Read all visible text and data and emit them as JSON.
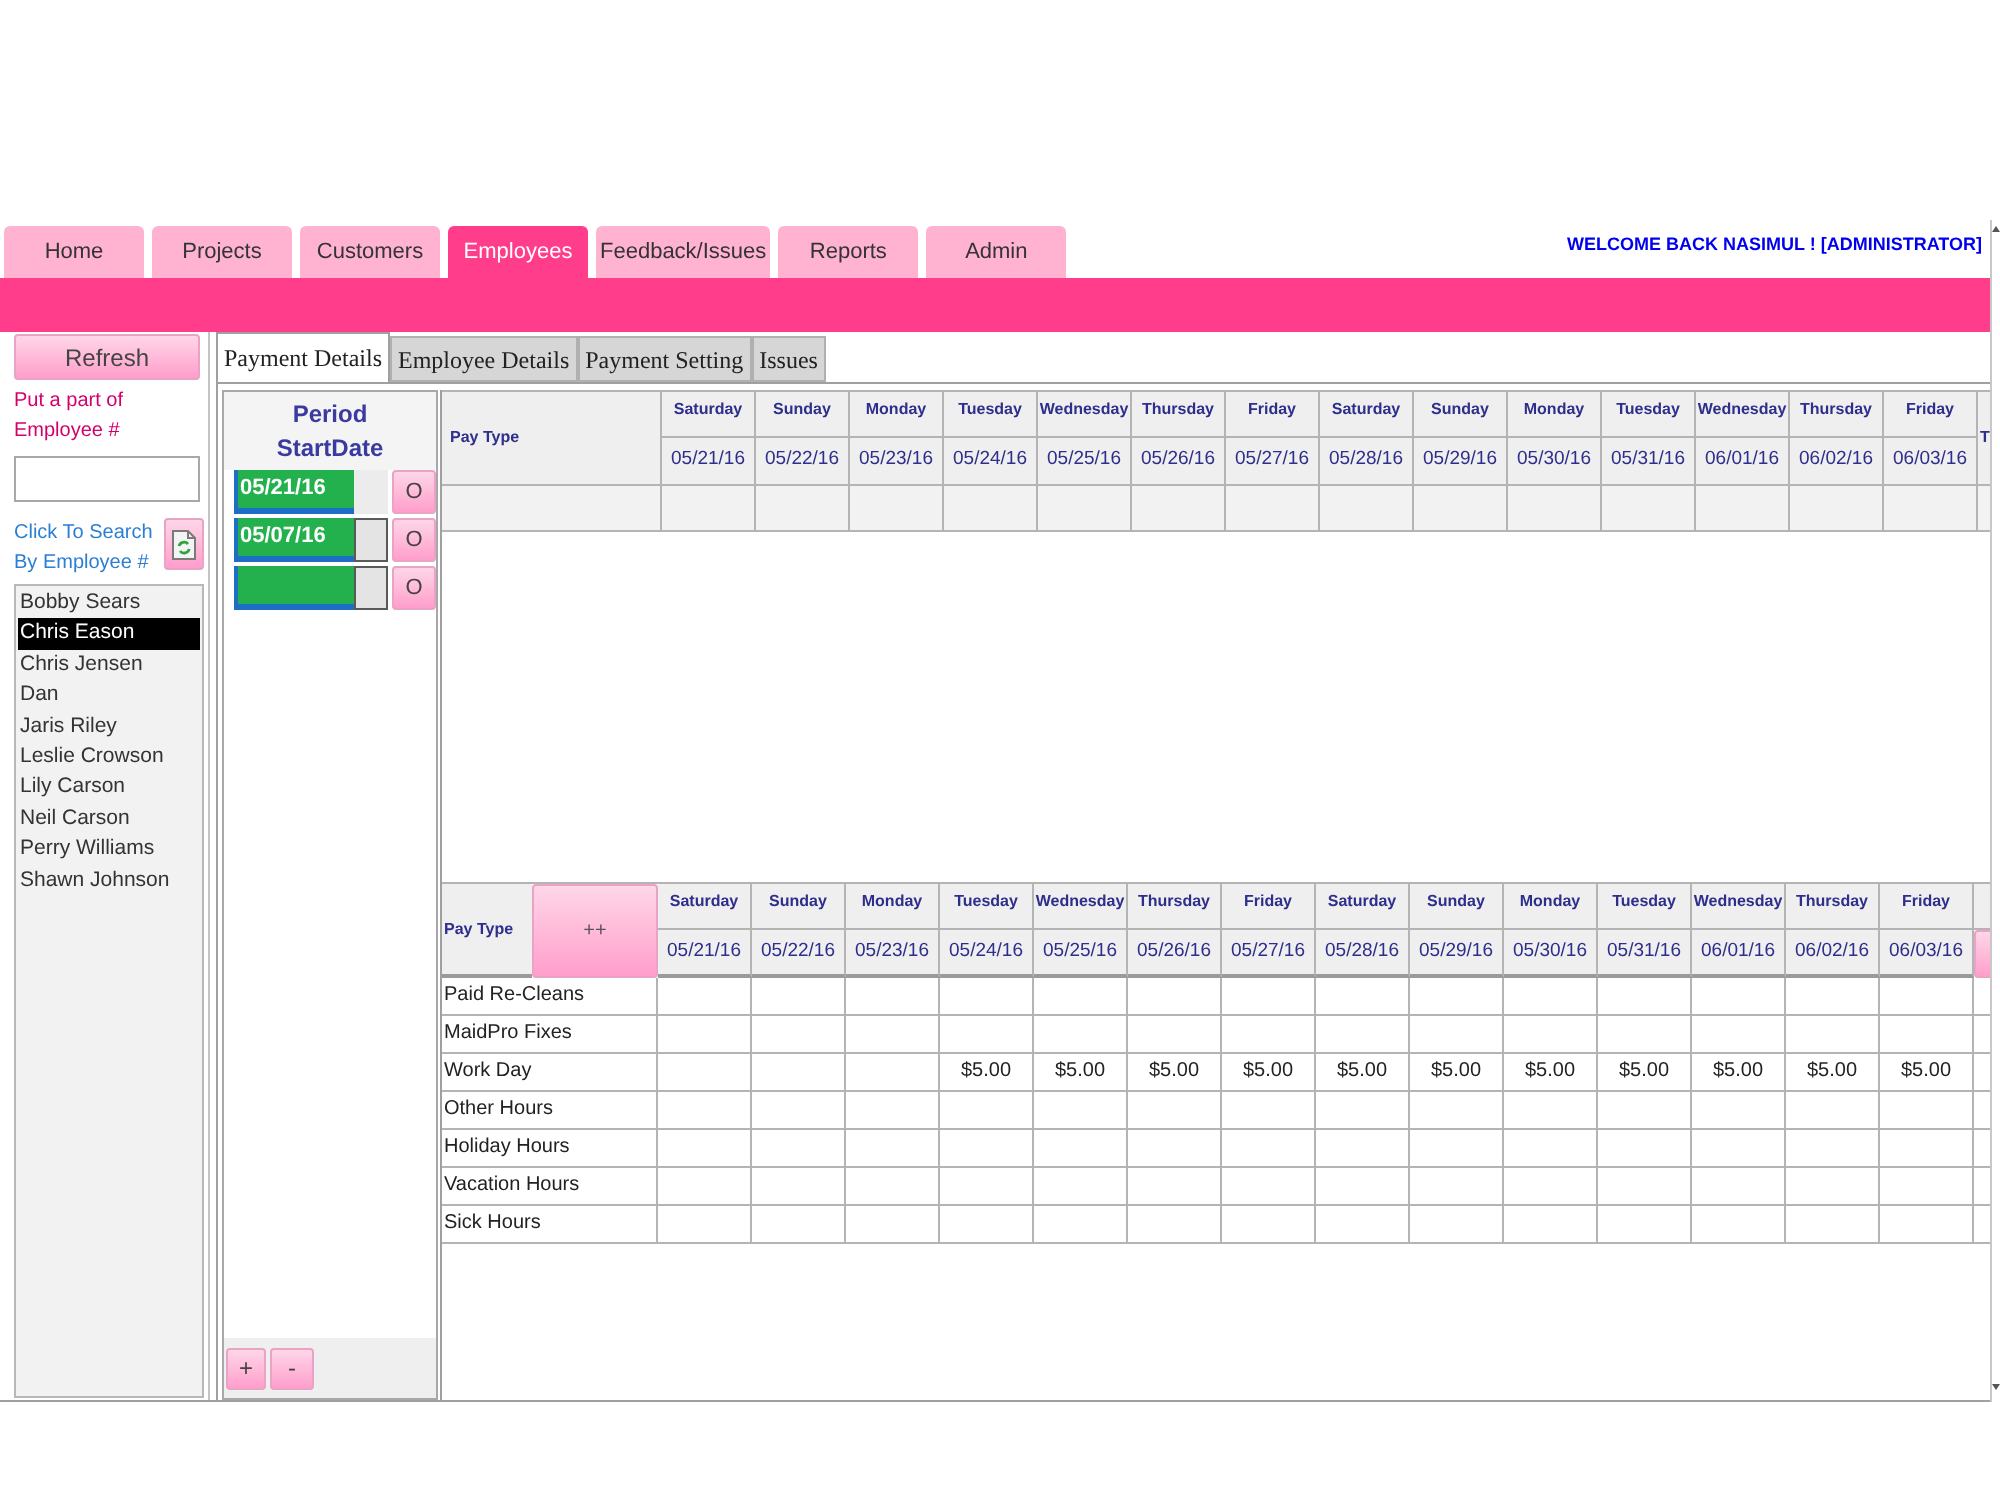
{
  "nav": {
    "tabs": [
      {
        "label": "Home",
        "selected": false
      },
      {
        "label": "Projects",
        "selected": false
      },
      {
        "label": "Customers",
        "selected": false
      },
      {
        "label": "Employees",
        "selected": true
      },
      {
        "label": "Feedback/Issues",
        "selected": false
      },
      {
        "label": "Reports",
        "selected": false
      },
      {
        "label": "Admin",
        "selected": false
      }
    ],
    "welcome": "WELCOME BACK NASIMUL ! [ADMINISTRATOR]"
  },
  "sidebar": {
    "refresh_button": "Refresh",
    "search_hint": "Put a part of Employee #",
    "search_label": "Click To Search By Employee #",
    "employees": [
      {
        "name": "Bobby Sears",
        "selected": false
      },
      {
        "name": "Chris Eason",
        "selected": true
      },
      {
        "name": "Chris Jensen",
        "selected": false
      },
      {
        "name": "Dan",
        "selected": false
      },
      {
        "name": "Jaris Riley",
        "selected": false
      },
      {
        "name": "Leslie Crowson",
        "selected": false
      },
      {
        "name": "Lily Carson",
        "selected": false
      },
      {
        "name": "Neil Carson",
        "selected": false
      },
      {
        "name": "Perry Williams",
        "selected": false
      },
      {
        "name": "Shawn Johnson",
        "selected": false
      }
    ]
  },
  "form_tabs": [
    {
      "label": "Payment Details",
      "selected": true
    },
    {
      "label": "Employee Details",
      "selected": false
    },
    {
      "label": "Payment Setting",
      "selected": false
    },
    {
      "label": "Issues",
      "selected": false
    }
  ],
  "periods": {
    "title": "Period StartDate",
    "rows": [
      {
        "date": "05/21/16",
        "button": "O",
        "selected": true
      },
      {
        "date": "05/07/16",
        "button": "O",
        "selected": false
      },
      {
        "button": "O",
        "selected": false
      }
    ],
    "add_button": "+",
    "remove_button": "-"
  },
  "top_grid": {
    "pay_type_header": "Pay Type",
    "columns": [
      {
        "day": "Saturday",
        "date": "05/21/16"
      },
      {
        "day": "Sunday",
        "date": "05/22/16"
      },
      {
        "day": "Monday",
        "date": "05/23/16"
      },
      {
        "day": "Tuesday",
        "date": "05/24/16"
      },
      {
        "day": "Wednesday",
        "date": "05/25/16"
      },
      {
        "day": "Thursday",
        "date": "05/26/16"
      },
      {
        "day": "Friday",
        "date": "05/27/16"
      },
      {
        "day": "Saturday",
        "date": "05/28/16"
      },
      {
        "day": "Sunday",
        "date": "05/29/16"
      },
      {
        "day": "Monday",
        "date": "05/30/16"
      },
      {
        "day": "Tuesday",
        "date": "05/31/16"
      },
      {
        "day": "Wednesday",
        "date": "06/01/16"
      },
      {
        "day": "Thursday",
        "date": "06/02/16"
      },
      {
        "day": "Friday",
        "date": "06/03/16"
      }
    ],
    "cut_column_header": "T"
  },
  "bottom_grid": {
    "pay_type_header": "Pay Type",
    "add_button": "++",
    "columns": [
      {
        "day": "Saturday",
        "date": "05/21/16"
      },
      {
        "day": "Sunday",
        "date": "05/22/16"
      },
      {
        "day": "Monday",
        "date": "05/23/16"
      },
      {
        "day": "Tuesday",
        "date": "05/24/16"
      },
      {
        "day": "Wednesday",
        "date": "05/25/16"
      },
      {
        "day": "Thursday",
        "date": "05/26/16"
      },
      {
        "day": "Friday",
        "date": "05/27/16"
      },
      {
        "day": "Saturday",
        "date": "05/28/16"
      },
      {
        "day": "Sunday",
        "date": "05/29/16"
      },
      {
        "day": "Monday",
        "date": "05/30/16"
      },
      {
        "day": "Tuesday",
        "date": "05/31/16"
      },
      {
        "day": "Wednesday",
        "date": "06/01/16"
      },
      {
        "day": "Thursday",
        "date": "06/02/16"
      },
      {
        "day": "Friday",
        "date": "06/03/16"
      }
    ],
    "rows": [
      {
        "label": "Paid Re-Cleans"
      },
      {
        "label": "MaidPro Fixes"
      },
      {
        "label": "Work Day",
        "values_from_right": [
          "$5.00",
          "$5.00",
          "$5.00",
          "$5.00",
          "$5.00",
          "$5.00",
          "$5.00",
          "$5.00",
          "$5.00",
          "$5.00",
          "$5.00"
        ]
      },
      {
        "label": "Other Hours"
      },
      {
        "label": "Holiday Hours"
      },
      {
        "label": "Vacation Hours"
      },
      {
        "label": "Sick Hours"
      }
    ]
  }
}
